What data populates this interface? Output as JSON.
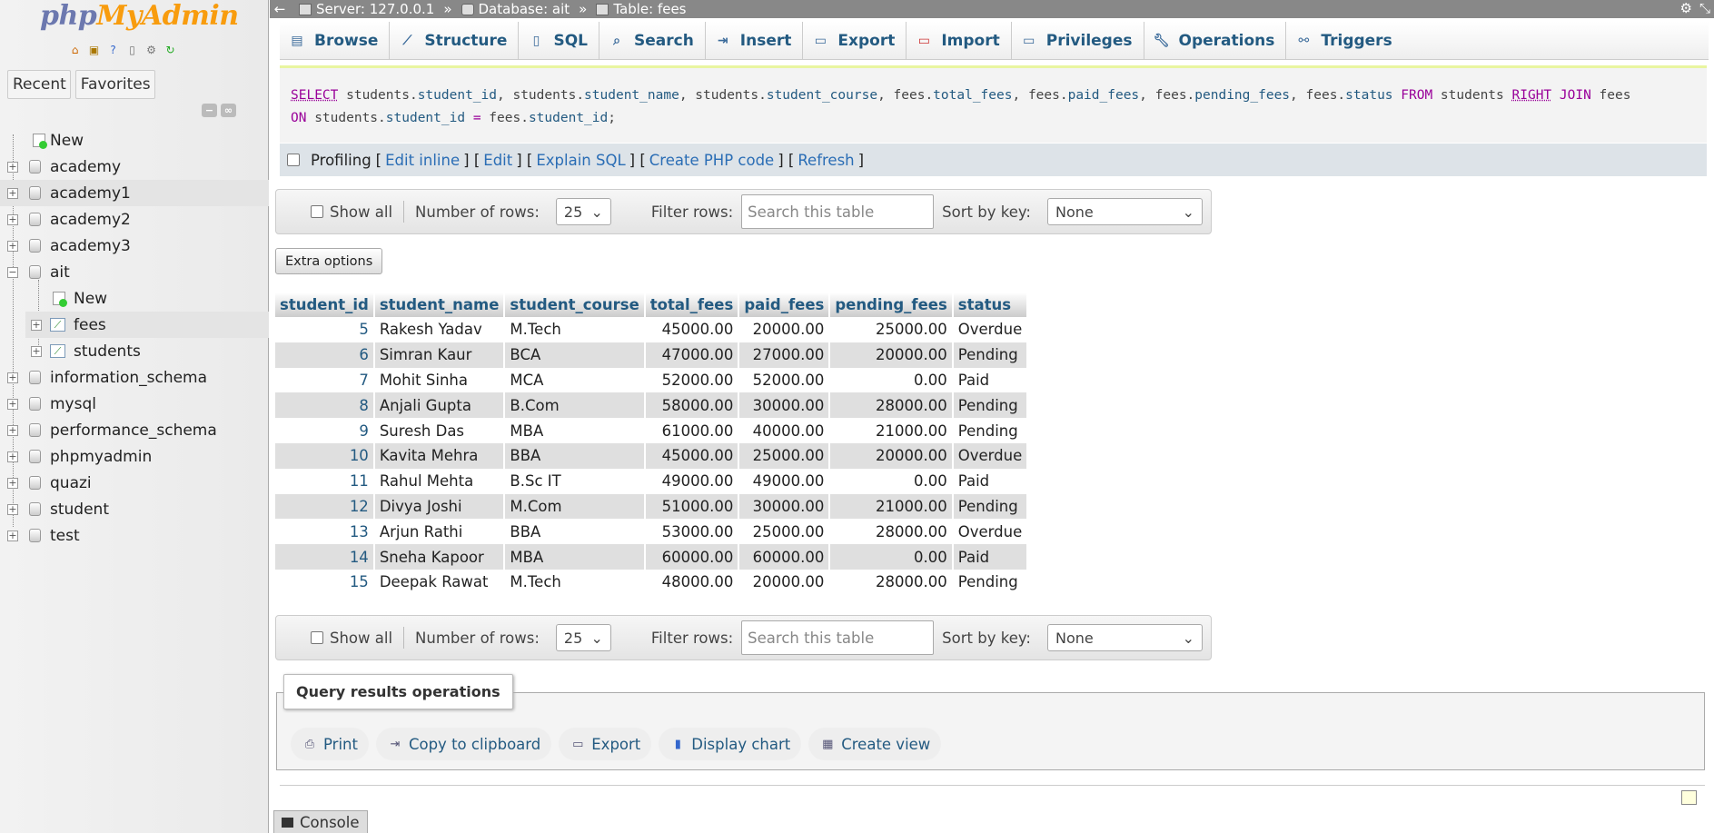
{
  "app": {
    "logo_php": "php",
    "logo_my": "MyAdmin"
  },
  "nav": {
    "tabs": {
      "recent": "Recent",
      "favorites": "Favorites"
    },
    "tree": [
      {
        "label": "New"
      },
      {
        "label": "academy"
      },
      {
        "label": "academy1"
      },
      {
        "label": "academy2"
      },
      {
        "label": "academy3"
      },
      {
        "label": "ait"
      },
      {
        "label": "New"
      },
      {
        "label": "fees"
      },
      {
        "label": "students"
      },
      {
        "label": "information_schema"
      },
      {
        "label": "mysql"
      },
      {
        "label": "performance_schema"
      },
      {
        "label": "phpmyadmin"
      },
      {
        "label": "quazi"
      },
      {
        "label": "student"
      },
      {
        "label": "test"
      }
    ]
  },
  "breadcrumb": {
    "server": "Server: 127.0.0.1",
    "database": "Database: ait",
    "table": "Table: fees",
    "sep": "»"
  },
  "menu": {
    "browse": "Browse",
    "structure": "Structure",
    "sql": "SQL",
    "search": "Search",
    "insert": "Insert",
    "export": "Export",
    "import": "Import",
    "privileges": "Privileges",
    "operations": "Operations",
    "triggers": "Triggers"
  },
  "sql": {
    "line1_parts": [
      "SELECT",
      " students.",
      "student_id",
      ", students.",
      "student_name",
      ", students.",
      "student_course",
      ", fees.",
      "total_fees",
      ", fees.",
      "paid_fees",
      ", fees.",
      "pending_fees",
      ", fees.",
      "status",
      " ",
      "FROM",
      " students ",
      "RIGHT",
      " ",
      "JOIN",
      " fees"
    ],
    "line2_parts": [
      "ON",
      " students.",
      "student_id",
      " ",
      "=",
      " fees.",
      "student_id",
      ";"
    ]
  },
  "sql_actions": {
    "profiling": "Profiling",
    "edit_inline": "Edit inline",
    "edit": "Edit",
    "explain": "Explain SQL",
    "php_code": "Create PHP code",
    "refresh": "Refresh"
  },
  "nav_controls": {
    "show_all": "Show all",
    "num_rows_label": "Number of rows:",
    "num_rows_value": "25",
    "filter_label": "Filter rows:",
    "filter_placeholder": "Search this table",
    "sort_label": "Sort by key:",
    "sort_value": "None"
  },
  "extra_options": "Extra options",
  "table": {
    "headers": [
      "student_id",
      "student_name",
      "student_course",
      "total_fees",
      "paid_fees",
      "pending_fees",
      "status"
    ],
    "rows": [
      [
        "5",
        "Rakesh Yadav",
        "M.Tech",
        "45000.00",
        "20000.00",
        "25000.00",
        "Overdue"
      ],
      [
        "6",
        "Simran Kaur",
        "BCA",
        "47000.00",
        "27000.00",
        "20000.00",
        "Pending"
      ],
      [
        "7",
        "Mohit Sinha",
        "MCA",
        "52000.00",
        "52000.00",
        "0.00",
        "Paid"
      ],
      [
        "8",
        "Anjali Gupta",
        "B.Com",
        "58000.00",
        "30000.00",
        "28000.00",
        "Pending"
      ],
      [
        "9",
        "Suresh Das",
        "MBA",
        "61000.00",
        "40000.00",
        "21000.00",
        "Pending"
      ],
      [
        "10",
        "Kavita Mehra",
        "BBA",
        "45000.00",
        "25000.00",
        "20000.00",
        "Overdue"
      ],
      [
        "11",
        "Rahul Mehta",
        "B.Sc IT",
        "49000.00",
        "49000.00",
        "0.00",
        "Paid"
      ],
      [
        "12",
        "Divya Joshi",
        "M.Com",
        "51000.00",
        "30000.00",
        "21000.00",
        "Pending"
      ],
      [
        "13",
        "Arjun Rathi",
        "BBA",
        "53000.00",
        "25000.00",
        "28000.00",
        "Overdue"
      ],
      [
        "14",
        "Sneha Kapoor",
        "MBA",
        "60000.00",
        "60000.00",
        "0.00",
        "Paid"
      ],
      [
        "15",
        "Deepak Rawat",
        "M.Tech",
        "48000.00",
        "20000.00",
        "28000.00",
        "Pending"
      ]
    ]
  },
  "query_ops": {
    "title": "Query results operations",
    "print": "Print",
    "copy": "Copy to clipboard",
    "export": "Export",
    "chart": "Display chart",
    "view": "Create view"
  },
  "console": "Console"
}
